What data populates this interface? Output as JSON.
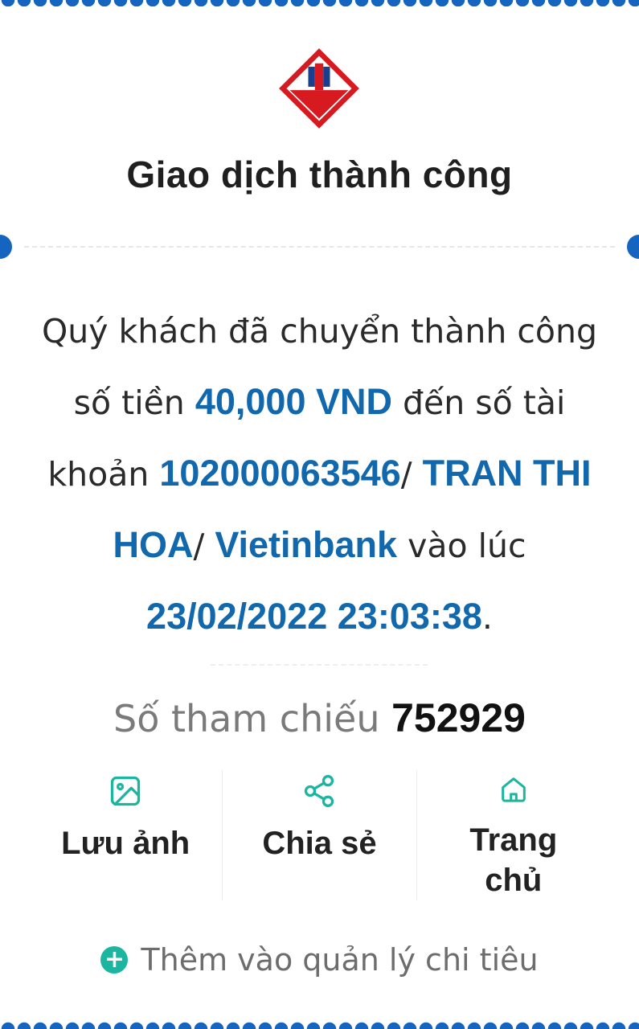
{
  "header": {
    "title": "Giao dịch thành công"
  },
  "message": {
    "part1": "Quý khách đã chuyển thành công số tiền ",
    "amount": "40,000 VND",
    "part2": " đến số tài khoản ",
    "account_number": "102000063546",
    "sep1": "/ ",
    "recipient_name": "TRAN THI HOA",
    "sep2": "/ ",
    "bank_name": "Vietinbank",
    "part3": " vào lúc ",
    "datetime": "23/02/2022 23:03:38",
    "end": "."
  },
  "reference": {
    "label": "Số tham chiếu",
    "value": "752929"
  },
  "actions": [
    {
      "label": "Lưu ảnh",
      "icon": "image-icon"
    },
    {
      "label": "Chia sẻ",
      "icon": "share-icon"
    },
    {
      "label": "Trang chủ",
      "icon": "home-icon"
    }
  ],
  "add_expense": {
    "label": "Thêm vào quản lý chi tiêu",
    "icon": "plus-circle-icon"
  },
  "colors": {
    "brand_blue": "#1565c0",
    "highlight": "#1168ac",
    "accent_teal": "#1bb5a0",
    "logo_red": "#d71920"
  }
}
